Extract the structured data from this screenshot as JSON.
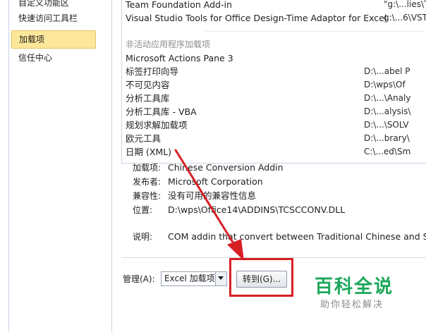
{
  "nav": {
    "items": [
      {
        "label": "自定义功能区",
        "selected": false
      },
      {
        "label": "快速访问工具栏",
        "selected": false
      },
      {
        "label": "加载项",
        "selected": true
      },
      {
        "label": "信任中心",
        "selected": false
      }
    ]
  },
  "addins": {
    "active_rows": [
      {
        "name": "Team Foundation Add-in",
        "path": "\"g:\\...lies\\T"
      },
      {
        "name": "Visual Studio Tools for Office Design-Time Adaptor for Excel",
        "path": "g:\\...6\\VST"
      }
    ],
    "inactive_header": "非活动应用程序加载项",
    "inactive_rows": [
      {
        "name": "Microsoft Actions Pane 3",
        "path": ""
      },
      {
        "name": "标签打印向导",
        "path": "D:\\...abel P"
      },
      {
        "name": "不可见内容",
        "path": "D:\\wps\\Of"
      },
      {
        "name": "分析工具库",
        "path": "D:\\...\\Analy"
      },
      {
        "name": "分析工具库 - VBA",
        "path": "D:\\...alysis\\"
      },
      {
        "name": "规划求解加载项",
        "path": "D:\\...\\SOLV"
      },
      {
        "name": "欧元工具",
        "path": "D:\\...brary\\"
      },
      {
        "name": "日期 (XML)",
        "path": "C:\\...ed\\Sm"
      }
    ]
  },
  "details": {
    "addin_label": "加载项:",
    "addin_value": "Chinese Conversion Addin",
    "publisher_label": "发布者:",
    "publisher_value": "Microsoft Corporation",
    "compat_label": "兼容性:",
    "compat_value": "没有可用的兼容性信息",
    "location_label": "位置:",
    "location_value": "D:\\wps\\Office14\\ADDINS\\TCSCCONV.DLL",
    "desc_label": "说明:",
    "desc_value": "COM addin that convert between Traditional Chinese and Simp"
  },
  "bottom": {
    "manage_label": "管理(A):",
    "manage_select": "Excel 加载项",
    "go_button": "转到(G)..."
  },
  "watermark": {
    "brand": "百科全说",
    "slogan": "助你轻松解决"
  },
  "colors": {
    "highlight_red": "#d62024",
    "selected_nav": "#fde79a",
    "watermark_green": "#1aa75a"
  }
}
